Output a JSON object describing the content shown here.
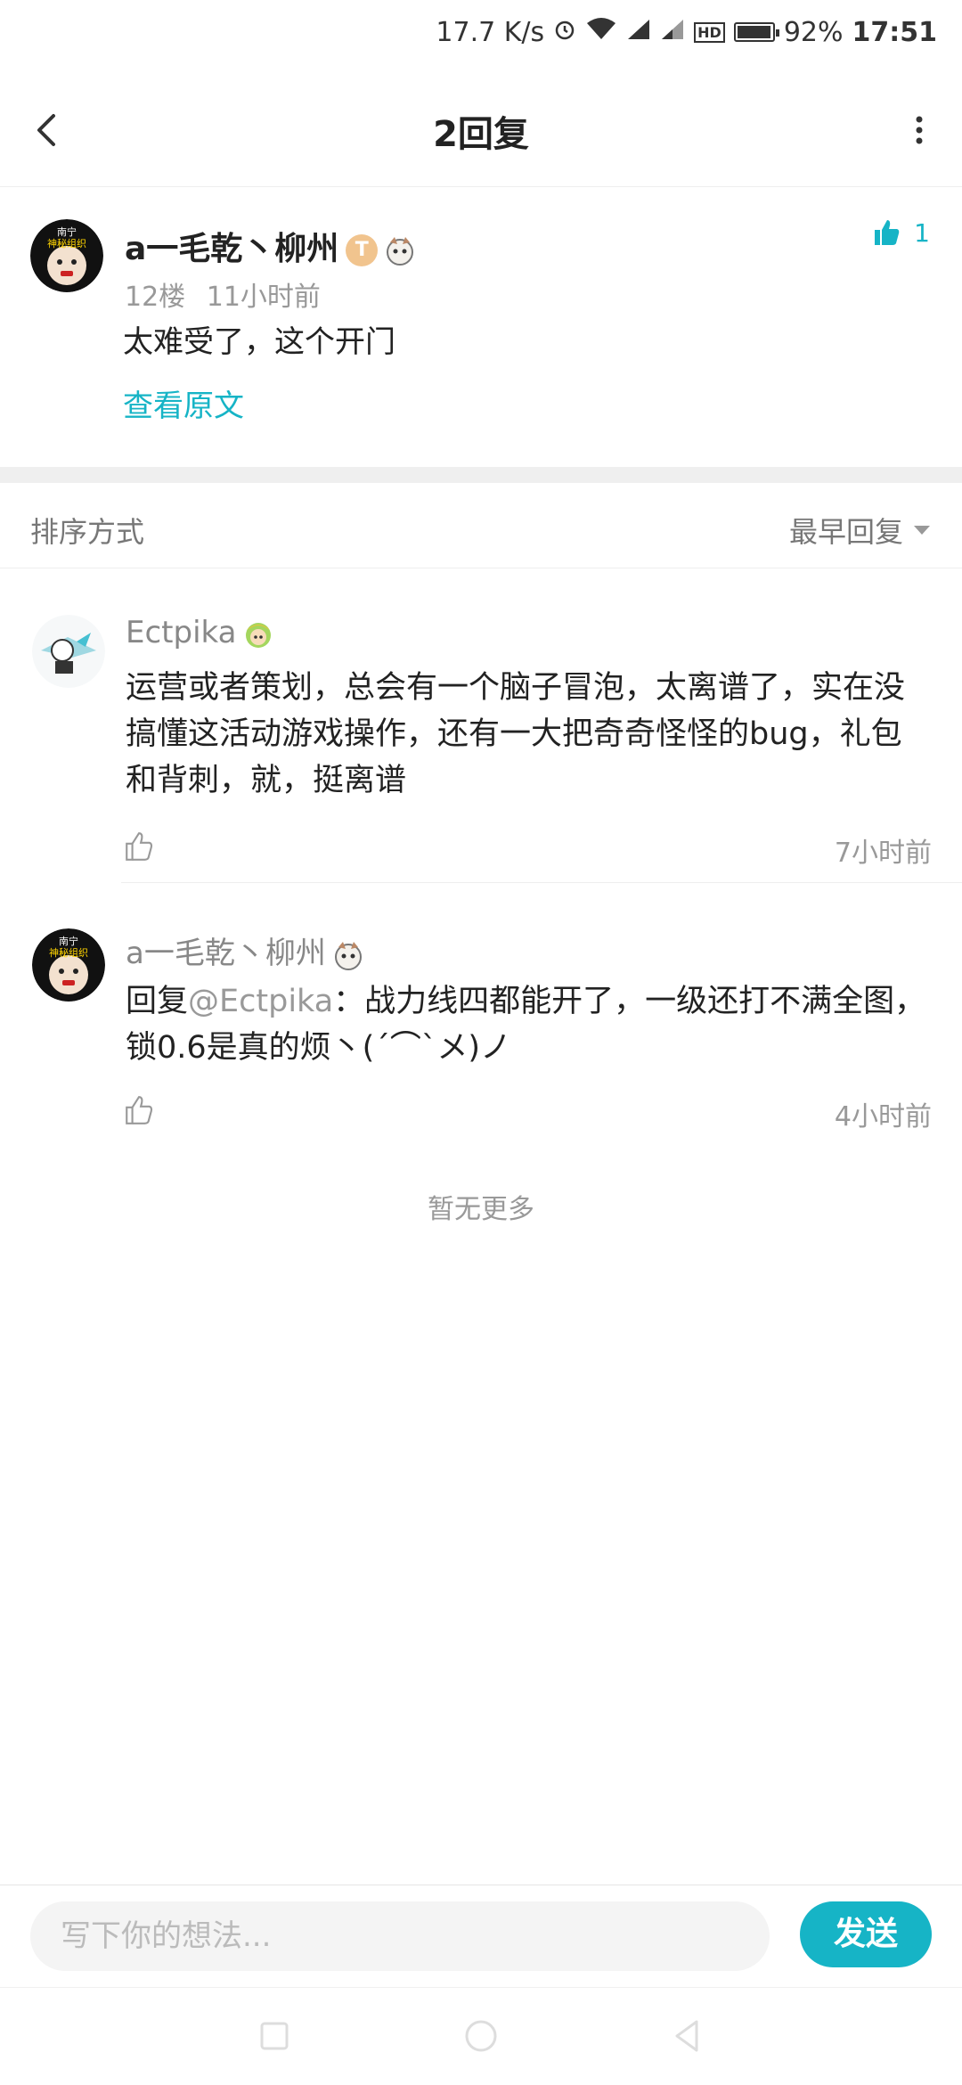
{
  "status_bar": {
    "net_speed": "17.7 K/s",
    "hd_label": "HD",
    "battery": "92%",
    "battery_level": 0.92,
    "time": "17:51"
  },
  "header": {
    "title": "2回复",
    "back_icon": "chevron-left-icon",
    "more_icon": "more-vertical-icon"
  },
  "post": {
    "author": "a一毛乾丶柳州",
    "badge_letter": "T",
    "floor": "12楼",
    "time": "11小时前",
    "content": "太难受了，这个开门",
    "view_original": "查看原文",
    "like_count": "1",
    "avatar_caption_1": "南宁",
    "avatar_caption_2": "神秘组织"
  },
  "sort": {
    "label": "排序方式",
    "selected": "最早回复"
  },
  "replies": [
    {
      "author": "Ectpika",
      "content": "运营或者策划，总会有一个脑子冒泡，太离谱了，实在没搞懂这活动游戏操作，还有一大把奇奇怪怪的bug，礼包和背刺，就，挺离谱",
      "time": "7小时前"
    },
    {
      "author": "a一毛乾丶柳州",
      "reply_prefix": "回复",
      "mention": "@Ectpika",
      "content": "：战力线四都能开了，一级还打不满全图，锁0.6是真的烦丶(ˊ⌒ˋメ)ノ",
      "time": "4小时前",
      "avatar_caption_1": "南宁",
      "avatar_caption_2": "神秘组织"
    }
  ],
  "no_more": "暂无更多",
  "composer": {
    "placeholder": "写下你的想法...",
    "send_label": "发送"
  },
  "colors": {
    "accent": "#16b4c6",
    "muted": "#999999",
    "text": "#222222"
  }
}
